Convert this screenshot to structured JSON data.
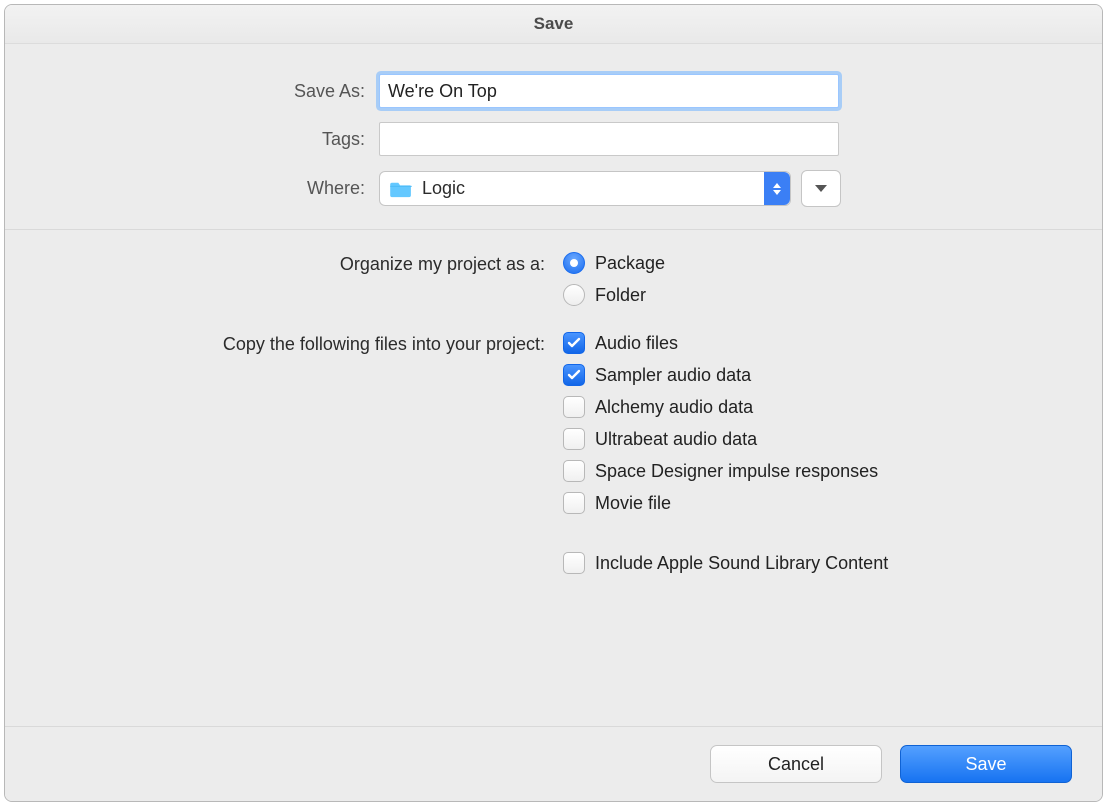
{
  "title": "Save",
  "fields": {
    "saveas_label": "Save As:",
    "saveas_value": "We're On Top",
    "tags_label": "Tags:",
    "tags_value": "",
    "where_label": "Where:",
    "where_value": "Logic"
  },
  "organize": {
    "label": "Organize my project as a:",
    "options": [
      {
        "label": "Package",
        "checked": true
      },
      {
        "label": "Folder",
        "checked": false
      }
    ]
  },
  "copy": {
    "label": "Copy the following files into your project:",
    "options": [
      {
        "label": "Audio files",
        "checked": true
      },
      {
        "label": "Sampler audio data",
        "checked": true
      },
      {
        "label": "Alchemy audio data",
        "checked": false
      },
      {
        "label": "Ultrabeat audio data",
        "checked": false
      },
      {
        "label": "Space Designer impulse responses",
        "checked": false
      },
      {
        "label": "Movie file",
        "checked": false
      }
    ],
    "include_label": "Include Apple Sound Library Content",
    "include_checked": false
  },
  "buttons": {
    "cancel": "Cancel",
    "save": "Save"
  }
}
